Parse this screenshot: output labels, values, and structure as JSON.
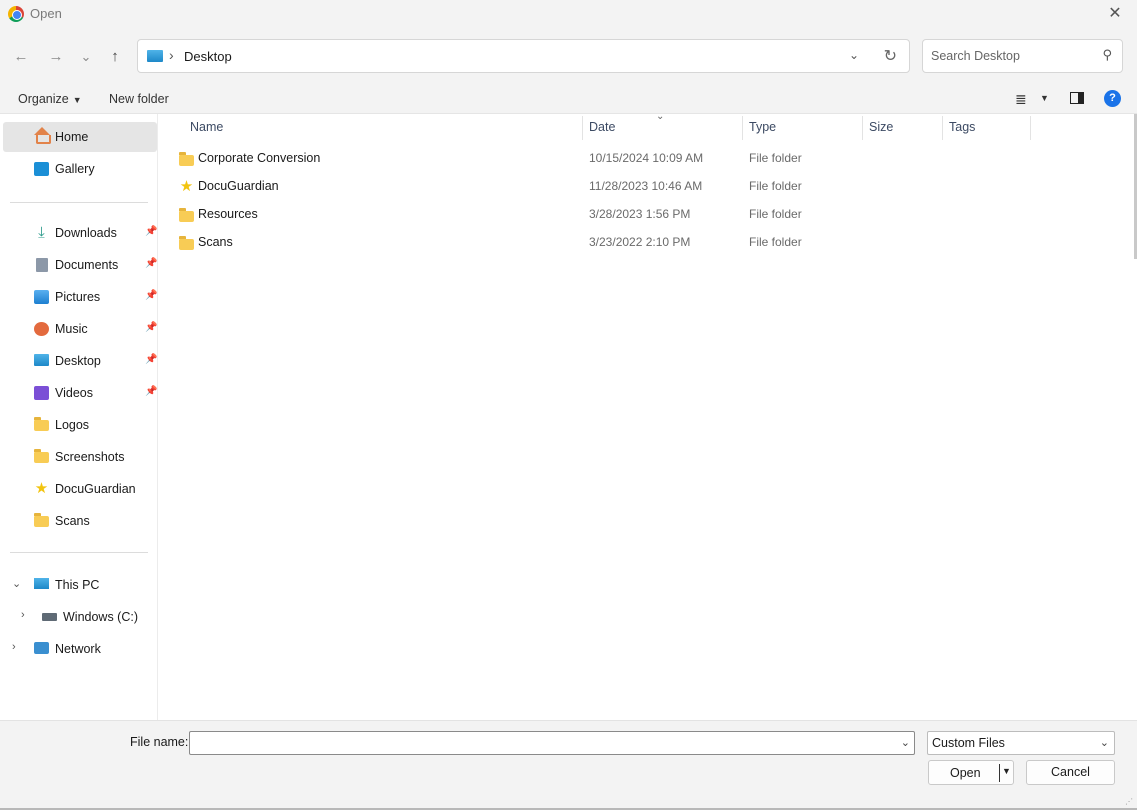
{
  "window": {
    "title": "Open",
    "close_label": "✕"
  },
  "nav": {
    "back": "←",
    "forward": "→",
    "recent": "⌄",
    "up": "↑",
    "location": "Desktop",
    "separator": "›",
    "search_placeholder": "Search Desktop"
  },
  "toolbar": {
    "organize_label": "Organize",
    "new_folder_label": "New folder",
    "view_icon": "≣",
    "help": "?"
  },
  "sidebar": {
    "quick": [
      {
        "label": "Home",
        "icon": "home-icon",
        "selected": true
      },
      {
        "label": "Gallery",
        "icon": "gallery-icon"
      }
    ],
    "pinned": [
      {
        "label": "Downloads",
        "icon": "downloads-icon",
        "pinned": true
      },
      {
        "label": "Documents",
        "icon": "documents-icon",
        "pinned": true
      },
      {
        "label": "Pictures",
        "icon": "pictures-icon",
        "pinned": true
      },
      {
        "label": "Music",
        "icon": "music-icon",
        "pinned": true
      },
      {
        "label": "Desktop",
        "icon": "desktop-icon",
        "pinned": true
      },
      {
        "label": "Videos",
        "icon": "videos-icon",
        "pinned": true
      },
      {
        "label": "Logos",
        "icon": "folder-icon"
      },
      {
        "label": "Screenshots",
        "icon": "folder-icon"
      },
      {
        "label": "DocuGuardian",
        "icon": "star-icon"
      },
      {
        "label": "Scans",
        "icon": "folder-icon"
      }
    ],
    "tree": [
      {
        "label": "This PC",
        "icon": "pc-icon",
        "expanded": true
      },
      {
        "label": "Windows (C:)",
        "icon": "drive-icon"
      },
      {
        "label": "Network",
        "icon": "network-icon"
      }
    ]
  },
  "columns": [
    "Name",
    "Date",
    "Type",
    "Size",
    "Tags"
  ],
  "files": [
    {
      "name": "Corporate Conversion",
      "date": "10/15/2024 10:09 AM",
      "type": "File folder",
      "size": "",
      "icon": "folder-icon"
    },
    {
      "name": "DocuGuardian",
      "date": "11/28/2023 10:46 AM",
      "type": "File folder",
      "size": "",
      "icon": "star-icon"
    },
    {
      "name": "Resources",
      "date": "3/28/2023 1:56 PM",
      "type": "File folder",
      "size": "",
      "icon": "folder-icon"
    },
    {
      "name": "Scans",
      "date": "3/23/2022 2:10 PM",
      "type": "File folder",
      "size": "",
      "icon": "folder-icon"
    }
  ],
  "footer": {
    "file_name_label": "File name:",
    "file_name_value": "",
    "filter_value": "Custom Files",
    "open_label": "Open",
    "cancel_label": "Cancel"
  },
  "colors": {
    "accent": "#1a73e8",
    "folder": "#f8cc55",
    "star": "#f2c40f",
    "selected_bg": "#e5e5e5",
    "chrome_bg": "#f3f3f3"
  }
}
